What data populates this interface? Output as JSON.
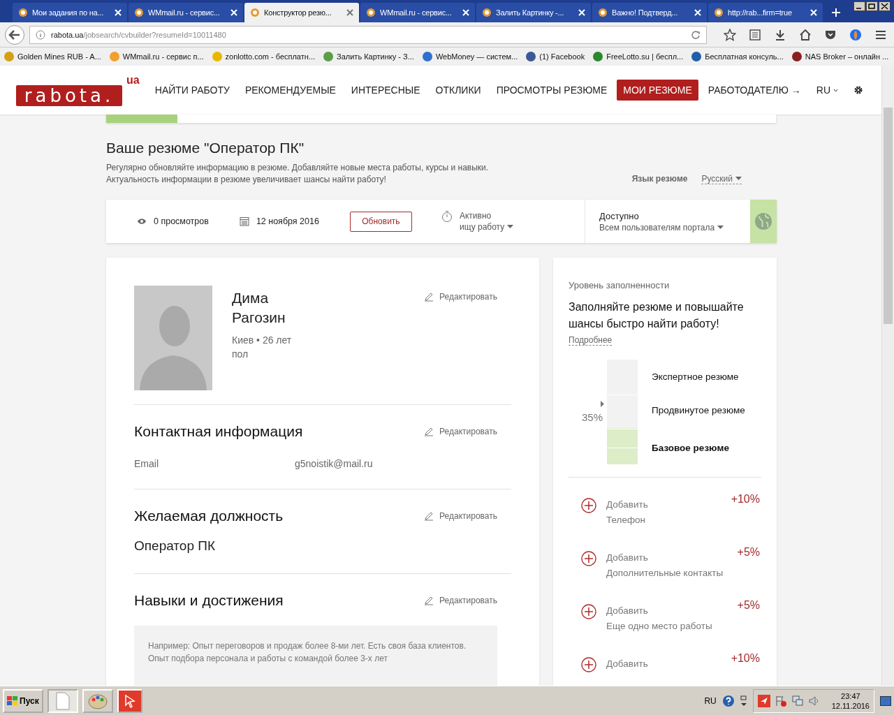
{
  "browser": {
    "tabs": [
      {
        "title": "Мои задания по на...",
        "selected": false
      },
      {
        "title": "WMmail.ru - сервис...",
        "selected": false
      },
      {
        "title": "Конструктор резю...",
        "selected": true
      },
      {
        "title": "WMmail.ru - сервис...",
        "selected": false
      },
      {
        "title": "Залить Картинку -...",
        "selected": false
      },
      {
        "title": "Важно! Подтверд...",
        "selected": false
      },
      {
        "title": "http://rab...firm=true",
        "selected": false
      }
    ],
    "address_host": "rabota.ua",
    "address_path": "/jobsearch/cvbuilder?resumeId=10011480",
    "bookmarks": [
      {
        "title": "Golden Mines RUB - A...",
        "color": "#d4a017"
      },
      {
        "title": "WMmail.ru - сервис п...",
        "color": "#f0a030"
      },
      {
        "title": "zonlotto.com - бесплатн...",
        "color": "#e8b800"
      },
      {
        "title": "Залить Картинку - З...",
        "color": "#5a9e4a"
      },
      {
        "title": "WebMoney — систем...",
        "color": "#2f6fd0"
      },
      {
        "title": "(1) Facebook",
        "color": "#3b5998"
      },
      {
        "title": "FreeLotto.su | беспл...",
        "color": "#2a8a2a"
      },
      {
        "title": "Бесплатная консуль...",
        "color": "#1f5fa8"
      },
      {
        "title": "NAS Broker – онлайн ...",
        "color": "#8a1f1f"
      }
    ]
  },
  "header": {
    "logo": "rabota.",
    "logo_suffix": "ua",
    "nav": [
      {
        "label": "НАЙТИ РАБОТУ",
        "selected": false
      },
      {
        "label": "РЕКОМЕНДУЕМЫЕ",
        "selected": false
      },
      {
        "label": "ИНТЕРЕСНЫЕ",
        "selected": false
      },
      {
        "label": "ОТКЛИКИ",
        "selected": false
      },
      {
        "label": "ПРОСМОТРЫ РЕЗЮМЕ",
        "selected": false
      },
      {
        "label": "МОИ РЕЗЮМЕ",
        "selected": true
      },
      {
        "label": "РАБОТОДАТЕЛЮ →",
        "selected": false
      }
    ],
    "language": "RU"
  },
  "resume": {
    "title": "Ваше резюме \"Оператор ПК\"",
    "hint_lines": [
      "Регулярно обновляйте информацию в резюме. Добавляйте новые места работы, курсы и навыки.",
      "Актуальность информации в резюме увеличивает шансы найти работу!"
    ],
    "language_label": "Язык резюме",
    "language_value": "Русский"
  },
  "status_bar": {
    "views": "0 просмотров",
    "date": "12 ноября 2016",
    "refresh_button": "Обновить",
    "activity_line_1": "Активно",
    "activity_line_2": "ищу работу",
    "access_title": "Доступно",
    "access_value": "Всем пользователям портала"
  },
  "profile": {
    "first_name": "Дима",
    "last_name": "Рагозин",
    "location": "Киев • 26 лет",
    "gender": "пол",
    "edit": "Редактировать"
  },
  "sections": [
    {
      "kind": "contacts",
      "title": "Контактная информация",
      "edit": "Редактировать",
      "label": "Email",
      "value": "g5noistik@mail.ru"
    },
    {
      "kind": "position",
      "title": "Желаемая должность",
      "edit": "Редактировать",
      "value": "Оператор ПК"
    },
    {
      "kind": "skills",
      "title": "Навыки и достижения",
      "edit": "Редактировать",
      "placeholder": "Например: Опыт переговоров и продаж более 8-ми лет. Есть своя база клиентов. Опыт подбора персонала и работы с командой более 3-х лет"
    }
  ],
  "completeness": {
    "caption": "Уровень заполненности",
    "headline": "Заполняйте резюме и повышайте шансы быстро найти работу!",
    "more_link": "Подробнее",
    "levels": [
      {
        "label": "Экспертное резюме",
        "current": false
      },
      {
        "label": "Продвинутое резюме",
        "current": false
      },
      {
        "label": "Базовое резюме",
        "current": true
      }
    ],
    "percent": "35%",
    "level": 0.35,
    "suggestions": [
      {
        "action": "Добавить",
        "item": "Телефон",
        "bonus": "+10%"
      },
      {
        "action": "Добавить",
        "item": "Дополнительные контакты",
        "bonus": "+5%"
      },
      {
        "action": "Добавить",
        "item": "Еще одно место работы",
        "bonus": "+5%"
      },
      {
        "action": "Добавить",
        "bonus": "+10%"
      }
    ]
  },
  "taskbar": {
    "start": "Пуск",
    "language": "RU",
    "time": "23:47",
    "date": "12.11.2016"
  }
}
